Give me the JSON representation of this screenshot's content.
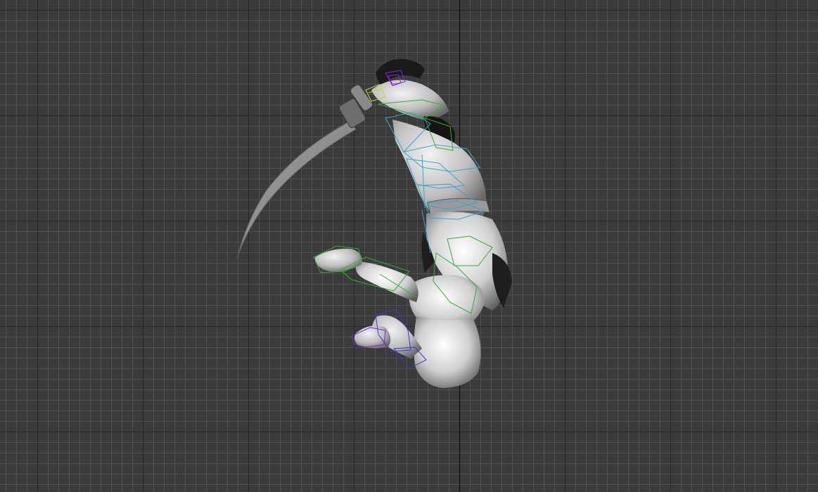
{
  "viewport": {
    "view": "orthographic",
    "grid": true,
    "background_color": "#3b3b3b",
    "grid_color": "#505050",
    "grid_major_color": "#282828",
    "axis_color": "#0a0a0a"
  },
  "scene": {
    "object": "character-model",
    "pose": "jumping-sword-slash",
    "rig": "biped",
    "rig_colors": [
      "#3aa6c8",
      "#2fb02f",
      "#7a2bd0",
      "#3a3ad8",
      "#b8e02a"
    ]
  }
}
